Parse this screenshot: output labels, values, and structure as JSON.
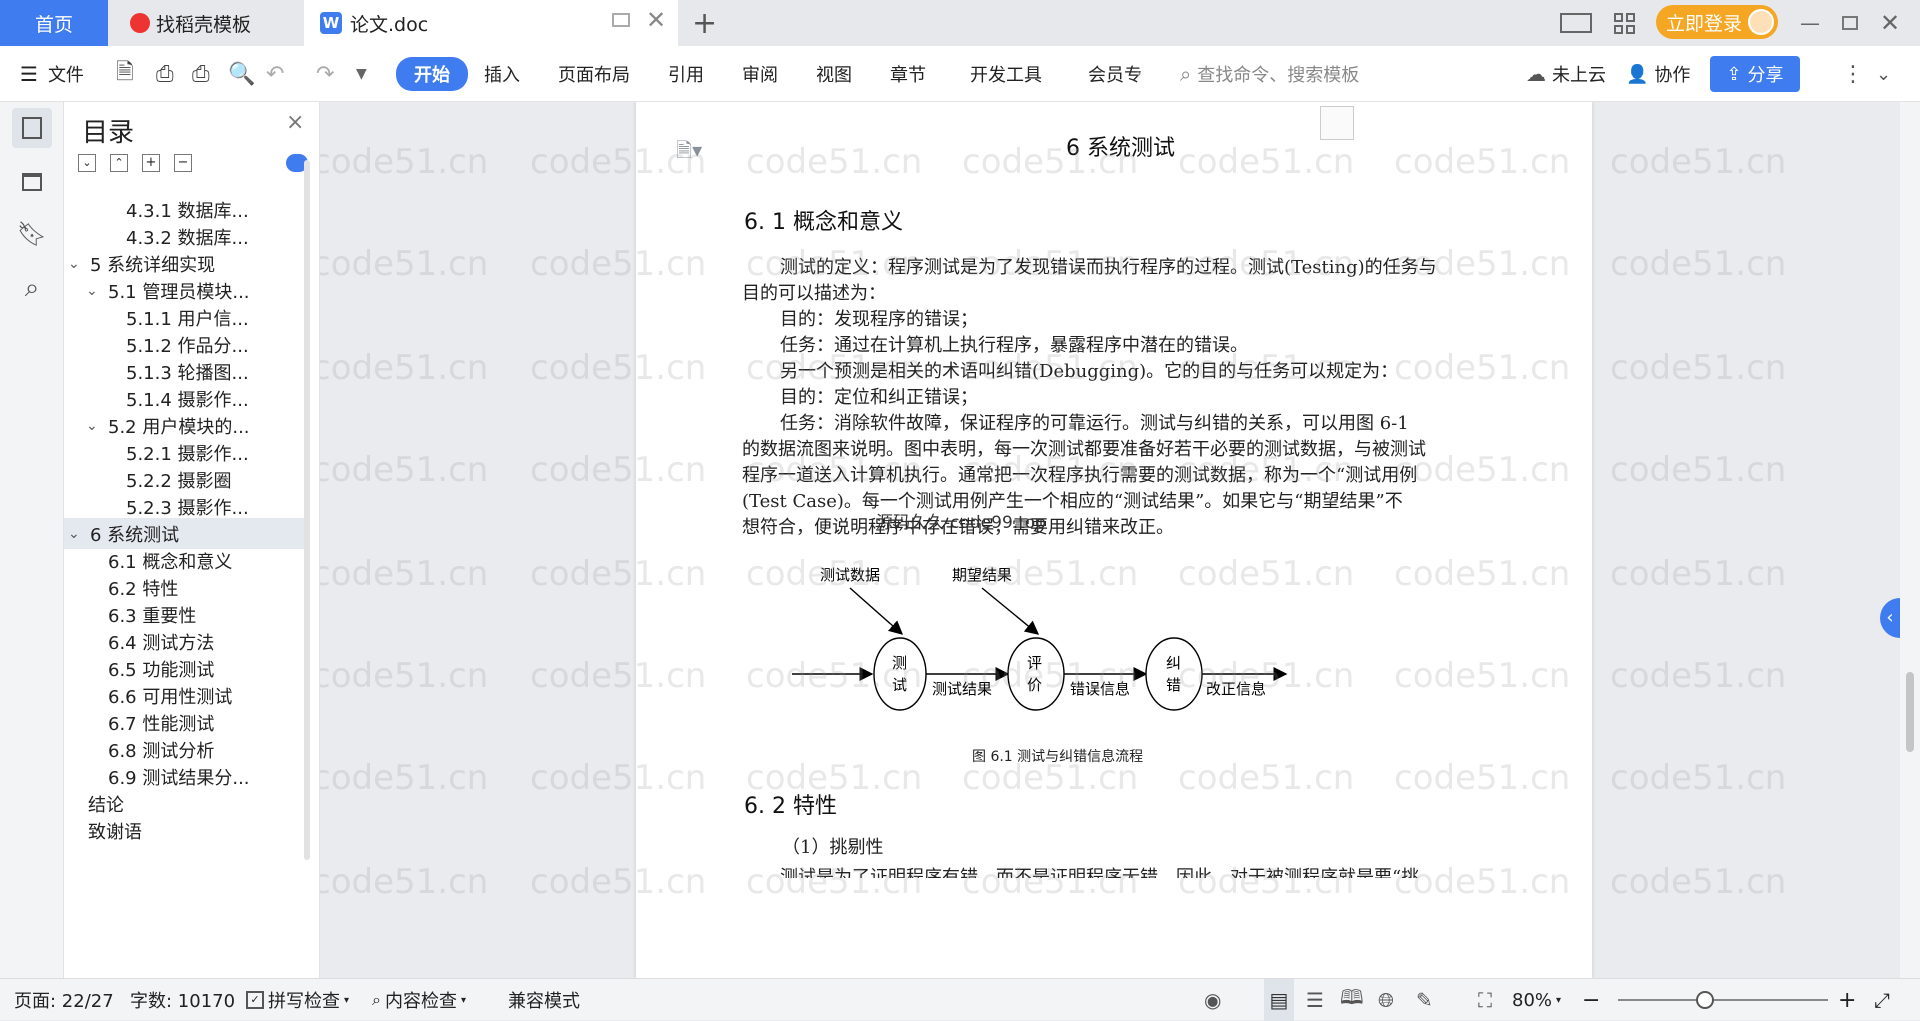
{
  "tabs": {
    "home": "首页",
    "templates": "找稻壳模板",
    "doc": "论文.doc",
    "login": "立即登录"
  },
  "toolbar": {
    "file": "文件",
    "menus": [
      "开始",
      "插入",
      "页面布局",
      "引用",
      "审阅",
      "视图",
      "章节",
      "开发工具",
      "会员专"
    ],
    "search_placeholder": "查找命令、搜索模板",
    "cloud": "未上云",
    "collab": "协作",
    "share": "分享"
  },
  "toc": {
    "title": "目录",
    "items": [
      {
        "label": "4.3.1 数据库...",
        "level": 3
      },
      {
        "label": "4.3.2 数据库...",
        "level": 3
      },
      {
        "label": "5 系统详细实现",
        "level": 1,
        "expand": true
      },
      {
        "label": "5.1  管理员模块...",
        "level": 2,
        "expand": true
      },
      {
        "label": "5.1.1  用户信...",
        "level": 3
      },
      {
        "label": "5.1.2  作品分...",
        "level": 3
      },
      {
        "label": "5.1.3  轮播图...",
        "level": 3
      },
      {
        "label": "5.1.4  摄影作...",
        "level": 3
      },
      {
        "label": "5.2  用户模块的...",
        "level": 2,
        "expand": true
      },
      {
        "label": "5.2.1  摄影作...",
        "level": 3
      },
      {
        "label": "5.2.2  摄影圈",
        "level": 3
      },
      {
        "label": "5.2.3  摄影作...",
        "level": 3
      },
      {
        "label": "6 系统测试",
        "level": 1,
        "expand": true,
        "active": true
      },
      {
        "label": "6.1 概念和意义",
        "level": 2
      },
      {
        "label": "6.2 特性",
        "level": 2
      },
      {
        "label": "6.3 重要性",
        "level": 2
      },
      {
        "label": "6.4 测试方法",
        "level": 2
      },
      {
        "label": "6.5  功能测试",
        "level": 2
      },
      {
        "label": "6.6 可用性测试",
        "level": 2
      },
      {
        "label": "6.7 性能测试",
        "level": 2
      },
      {
        "label": "6.8 测试分析",
        "level": 2
      },
      {
        "label": "6.9 测试结果分...",
        "level": 2
      },
      {
        "label": "结论",
        "level": 1
      },
      {
        "label": "致谢语",
        "level": 1
      }
    ]
  },
  "document": {
    "chapter_title": "6 系统测试",
    "section1": "6. 1 概念和意义",
    "paras": [
      "测试的定义：程序测试是为了发现错误而执行程序的过程。测试(Testing)的任务与",
      "目的可以描述为：",
      "目的：发现程序的错误；",
      "任务：通过在计算机上执行程序，暴露程序中潜在的错误。",
      "另一个预测是相关的术语叫纠错(Debugging)。它的目的与任务可以规定为：",
      "目的：定位和纠正错误；",
      "任务：消除软件故障，保证程序的可靠运行。测试与纠错的关系，可以用图 6-1",
      "的数据流图来说明。图中表明，每一次测试都要准备好若干必要的测试数据，与被测试",
      "程序一道送入计算机执行。通常把一次程序执行需要的测试数据，称为一个“测试用例",
      "(Test Case)。每一个测试用例产生一个相应的“测试结果”。如果它与“期望结果”不",
      "想符合，便说明程序中存在错误，需要用纠错来改正。"
    ],
    "overlay_text": "源码久久-code99.top",
    "diagram": {
      "input1": "测试数据",
      "input2": "期望结果",
      "node1": [
        "测",
        "试"
      ],
      "node2": [
        "评",
        "价"
      ],
      "node3": [
        "纠",
        "错"
      ],
      "edge1": "测试结果",
      "edge2": "错误信息",
      "edge3": "改正信息"
    },
    "figure_caption": "图 6.1 测试与纠错信息流程",
    "section2": "6. 2 特性",
    "item1": "（1）挑剔性",
    "cut_line": "测试是为了证明程序有错，而不是证明程序无错。因此，对于被测程序就是要“挑"
  },
  "watermark": "code51.cn",
  "status": {
    "page": "页面: 22/27",
    "words": "字数: 10170",
    "spell": "拼写检查",
    "content": "内容检查",
    "compat": "兼容模式",
    "zoom": "80%"
  },
  "colors": {
    "accent": "#3f7cf0",
    "login": "#f5a623"
  }
}
